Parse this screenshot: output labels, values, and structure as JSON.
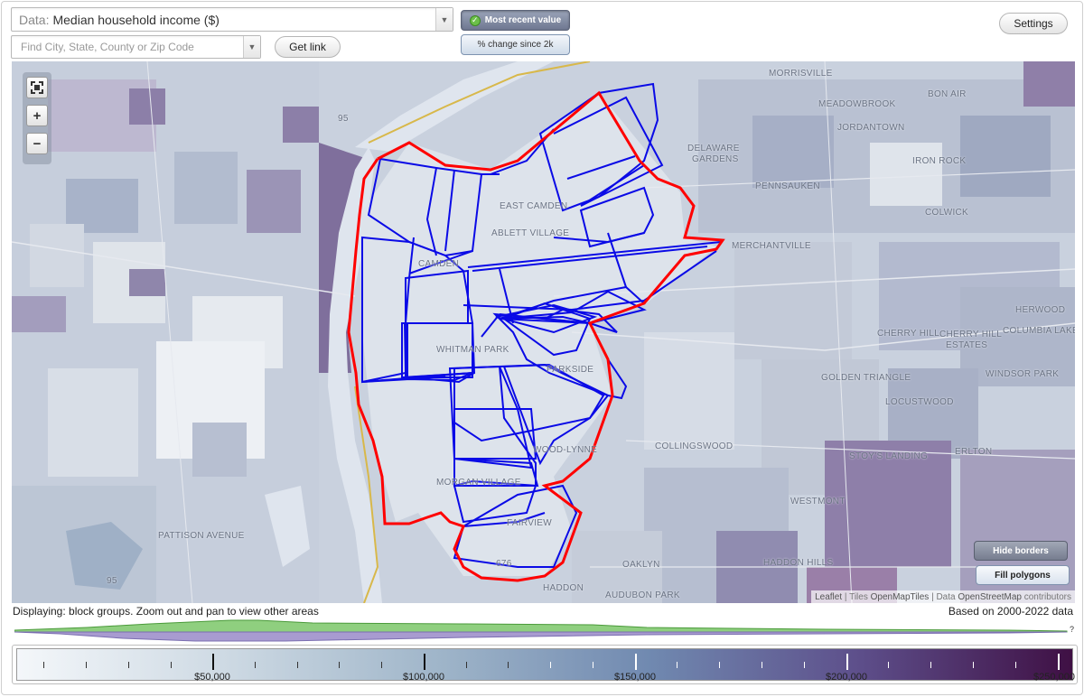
{
  "controls": {
    "data_label": "Data:",
    "data_value": "Median household income ($)",
    "search_placeholder": "Find City, State, County or Zip Code",
    "get_link": "Get link",
    "settings": "Settings",
    "mode_recent": "Most recent value",
    "mode_change": "% change since 2k"
  },
  "map": {
    "places": [
      "MORRISVILLE",
      "BON AIR",
      "MEADOWBROOK",
      "JORDANTOWN",
      "DELAWARE",
      "GARDENS",
      "IRON ROCK",
      "PENNSAUKEN",
      "COLWICK",
      "EAST CAMDEN",
      "ABLETT VILLAGE",
      "MERCHANTVILLE",
      "CAMDEN",
      "WHITMAN PARK",
      "PARKSIDE",
      "CHERRY HILL",
      "CHERRY HILL",
      "ESTATES",
      "HERWOOD",
      "COLUMBIA LAKE",
      "GOLDEN TRIANGLE",
      "WINDSOR PARK",
      "LOCUSTWOOD",
      "COLLINGSWOOD",
      "WOOD-LYNNE",
      "ERLTON",
      "STOY'S LANDING",
      "MORGAN VILLAGE",
      "FAIRVIEW",
      "WESTMONT",
      "PATTISON AVENUE",
      "HADDON HILLS",
      "OAKLYN",
      "HADDON",
      "AUDUBON PARK",
      "95",
      "676",
      "95"
    ],
    "hide_borders": "Hide borders",
    "fill_polygons": "Fill polygons",
    "attribution": {
      "leaflet": "Leaflet",
      "tiles_prefix": "| Tiles",
      "tiles": "OpenMapTiles",
      "data_prefix": "| Data",
      "data": "OpenStreetMap",
      "suffix": "contributors"
    },
    "colors": {
      "outer_border": "#ff0000",
      "tract_border": "#0000ff"
    }
  },
  "status": "Displaying: block groups. Zoom out and pan to view other areas",
  "based_on": "Based on 2000-2022 data",
  "histogram_marker": "?",
  "legend": {
    "labels": [
      "$50,000",
      "$100,000",
      "$150,000",
      "$200,000",
      "$250,000"
    ]
  }
}
